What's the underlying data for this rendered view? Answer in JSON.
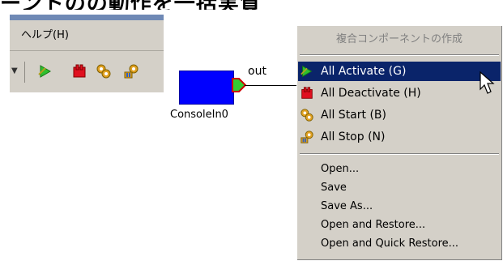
{
  "page": {
    "heading": "ーントのの動作を一括実質"
  },
  "toolbar": {
    "menu_help": "ヘルプ(H)",
    "icons": [
      "activate-icon",
      "deactivate-icon",
      "start-icon",
      "stop-icon"
    ]
  },
  "component": {
    "name": "ConsoleIn0",
    "port_label": "out",
    "fill_color": "#0000ff",
    "port_color": "#33cc33"
  },
  "context_menu": {
    "title": "複合コンポーネントの作成",
    "items": [
      {
        "label": "All Activate (G)",
        "icon": "activate-icon",
        "selected": true
      },
      {
        "label": "All Deactivate (H)",
        "icon": "deactivate-icon",
        "selected": false
      },
      {
        "label": "All Start (B)",
        "icon": "start-icon",
        "selected": false
      },
      {
        "label": "All Stop (N)",
        "icon": "stop-icon",
        "selected": false
      }
    ],
    "file_items": [
      {
        "label": "Open..."
      },
      {
        "label": "Save"
      },
      {
        "label": "Save As..."
      },
      {
        "label": "Open and Restore..."
      },
      {
        "label": "Open and Quick Restore..."
      }
    ],
    "highlight_color": "#0a246a"
  }
}
